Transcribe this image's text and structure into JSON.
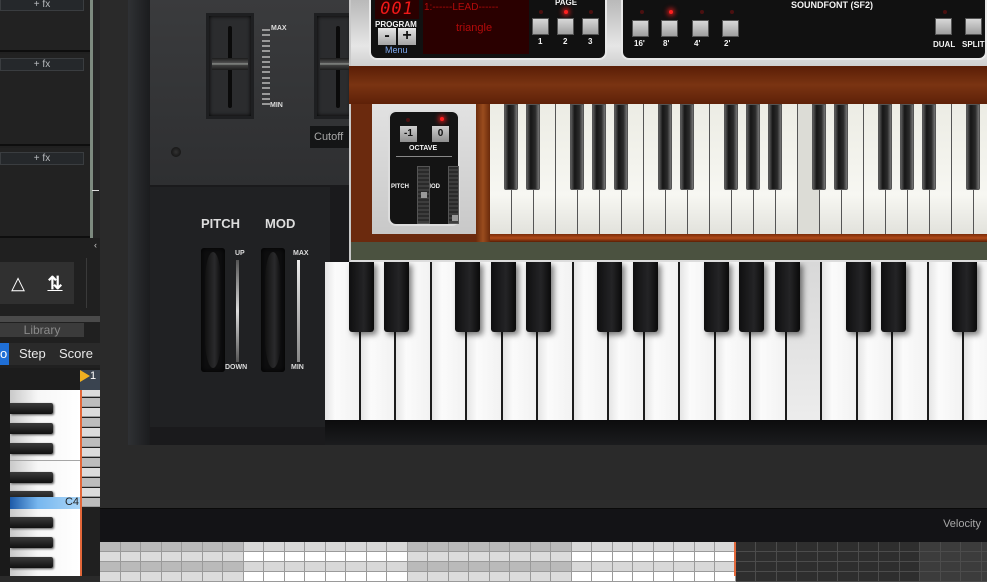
{
  "mixer": {
    "fx_buttons": [
      "+ fx",
      "+ fx",
      "+ fx"
    ],
    "collapse_icon": "chevron-left-icon"
  },
  "toolbar": {
    "metronome_icon": "metronome-icon",
    "metronome_glyph": "△",
    "sort_icon": "up-down-arrows-icon",
    "sort_glyph": "⇅"
  },
  "library": {
    "label": "Library"
  },
  "editor_tabs": [
    {
      "label": "o",
      "active": true
    },
    {
      "label": "Step",
      "active": false
    },
    {
      "label": "Score",
      "active": false
    }
  ],
  "piano_roll": {
    "marker_number": "1",
    "highlighted_key": "C4"
  },
  "synth": {
    "fader_scale_max": "MAX",
    "fader_scale_min": "MIN",
    "cutoff_label": "Cutoff",
    "pitch_label": "PITCH",
    "mod_label": "MOD",
    "pitch_up": "UP",
    "pitch_down": "DOWN",
    "mod_max": "MAX",
    "mod_min": "MIN"
  },
  "sf2_player": {
    "program_number": "001",
    "program_label": "PROGRAM",
    "minus_label": "-",
    "plus_label": "+",
    "menu_label": "Menu",
    "patch_line1": "1:------LEAD------",
    "patch_line2": "triangle",
    "page_label": "PAGE",
    "pages": [
      {
        "label": "1",
        "active": false
      },
      {
        "label": "2",
        "active": true
      },
      {
        "label": "3",
        "active": false
      }
    ],
    "title": "SOUNDFONT (SF2)",
    "footages": [
      {
        "label": "16'",
        "active": false
      },
      {
        "label": "8'",
        "active": true
      },
      {
        "label": "4'",
        "active": false
      },
      {
        "label": "2'",
        "active": false
      }
    ],
    "dual_label": "DUAL",
    "split_label": "SPLIT",
    "octave_minus": "-1",
    "octave_zero": "0",
    "octave_label": "OCTAVE",
    "pitch_label": "PITCH",
    "mod_label": "MOD"
  },
  "velocity": {
    "label": "Velocity"
  },
  "colors": {
    "accent_tab": "#1f6fd6",
    "playhead": "#e2673a",
    "led_red": "#ff2020",
    "lcd_text": "#b30a0a"
  }
}
